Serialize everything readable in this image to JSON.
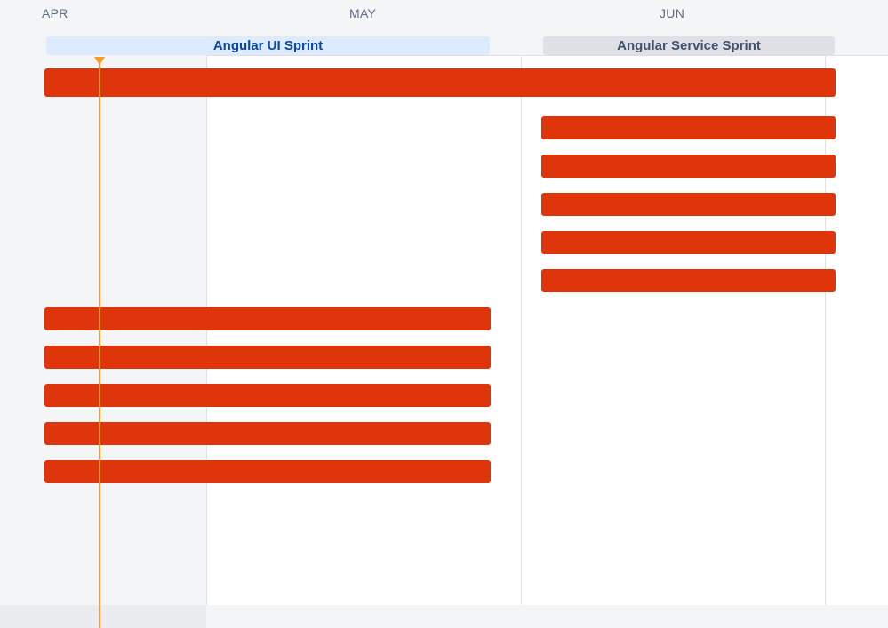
{
  "header": {
    "months": [
      {
        "label": "APR"
      },
      {
        "label": "MAY"
      },
      {
        "label": "JUN"
      }
    ],
    "sprints": [
      {
        "label": "Angular UI Sprint"
      },
      {
        "label": "Angular Service Sprint"
      }
    ]
  },
  "colors": {
    "bar": "#de350b",
    "today_marker": "#ff991f",
    "sprint_active_bg": "#deebff",
    "sprint_active_text": "#0747a6",
    "sprint_future_bg": "#dfe1e6",
    "sprint_future_text": "#42526e"
  },
  "icons": [
    "today-marker-icon"
  ]
}
